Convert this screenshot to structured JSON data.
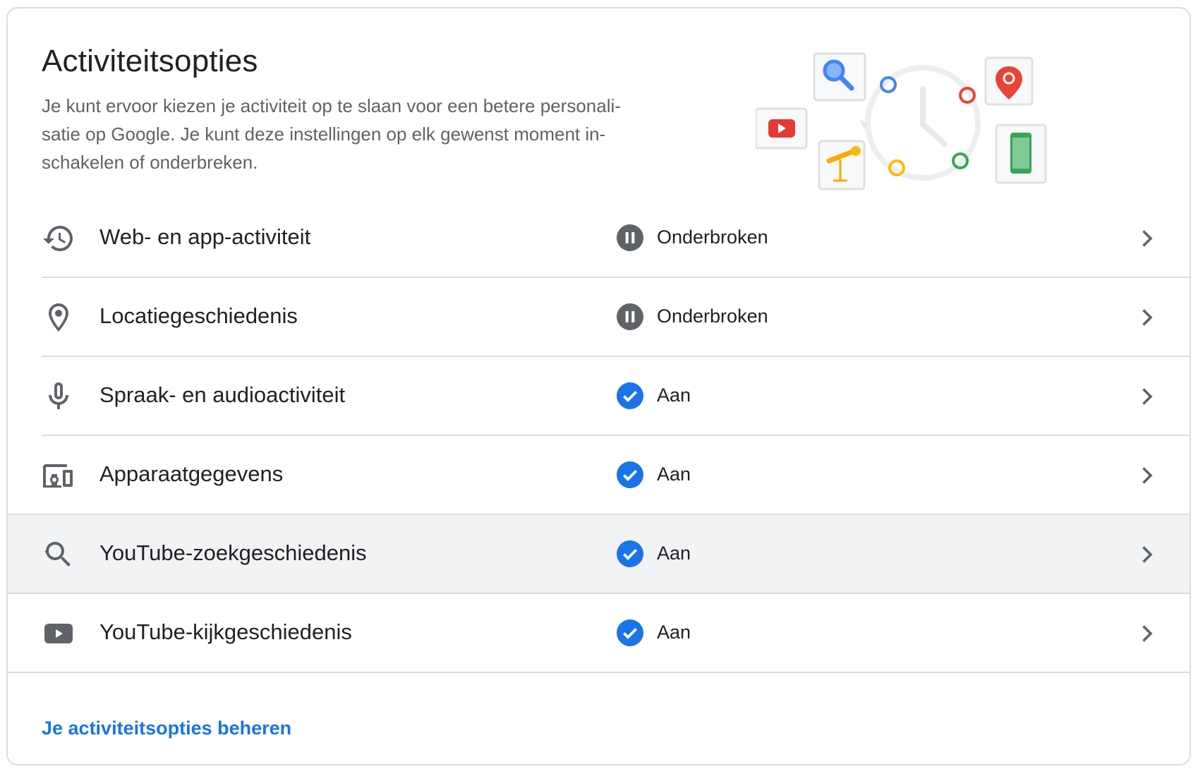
{
  "card": {
    "title": "Activiteitsopties",
    "description_lines": [
      "Je kunt ervoor kiezen je activiteit op te slaan voor een betere personali-",
      "satie op Google. Je kunt deze instellingen op elk gewenst moment in-",
      "schakelen of onderbreken."
    ]
  },
  "rows": [
    {
      "label": "Web- en app-activiteit",
      "status": "Onderbroken",
      "state": "paused",
      "icon": "history-icon"
    },
    {
      "label": "Locatiegeschiedenis",
      "status": "Onderbroken",
      "state": "paused",
      "icon": "location-pin-icon"
    },
    {
      "label": "Spraak- en audioactiviteit",
      "status": "Aan",
      "state": "on",
      "icon": "microphone-icon"
    },
    {
      "label": "Apparaatgegevens",
      "status": "Aan",
      "state": "on",
      "icon": "devices-icon"
    },
    {
      "label": "YouTube-zoekgeschiedenis",
      "status": "Aan",
      "state": "on",
      "icon": "search-history-icon"
    },
    {
      "label": "YouTube-kijkgeschiedenis",
      "status": "Aan",
      "state": "on",
      "icon": "youtube-icon"
    }
  ],
  "footer": {
    "manage_link": "Je activiteitsopties beheren"
  },
  "colors": {
    "accent_blue": "#1a73e8",
    "paused_gray": "#5f6368",
    "divider": "#dadce0",
    "highlight_row": "#f1f3f4"
  }
}
